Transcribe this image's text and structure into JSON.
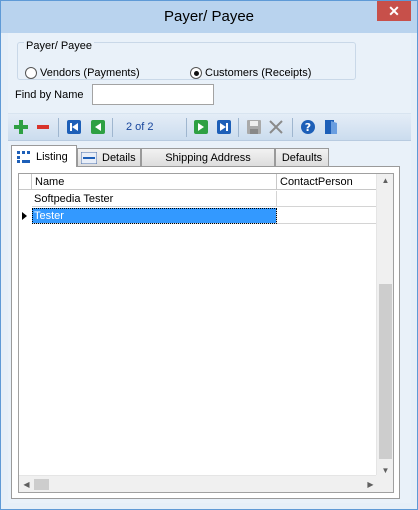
{
  "window": {
    "title": "Payer/ Payee",
    "close_label": "✕"
  },
  "filter": {
    "group_label": "Payer/ Payee",
    "options": [
      {
        "label": "Vendors (Payments)",
        "checked": false
      },
      {
        "label": "Customers (Receipts)",
        "checked": true
      }
    ],
    "find_label": "Find by Name",
    "find_value": ""
  },
  "toolbar": {
    "record_text": "2 of 2",
    "buttons": [
      "add-icon",
      "delete-icon",
      "first-record-icon",
      "previous-record-icon",
      "next-record-icon",
      "last-record-icon",
      "save-icon",
      "cancel-icon",
      "help-icon",
      "exit-icon"
    ]
  },
  "tabs": [
    {
      "label": "Listing",
      "active": true
    },
    {
      "label": "Details",
      "active": false
    },
    {
      "label": "Shipping Address",
      "active": false
    },
    {
      "label": "Defaults",
      "active": false
    }
  ],
  "grid": {
    "columns": [
      "Name",
      "ContactPerson"
    ],
    "rows": [
      {
        "name": "Softpedia Tester",
        "contact": "",
        "selected": false
      },
      {
        "name": "Tester",
        "contact": "",
        "selected": true
      }
    ]
  },
  "colors": {
    "accent": "#3399ff",
    "title_bar": "#b9d3ee",
    "close": "#c7504a"
  }
}
